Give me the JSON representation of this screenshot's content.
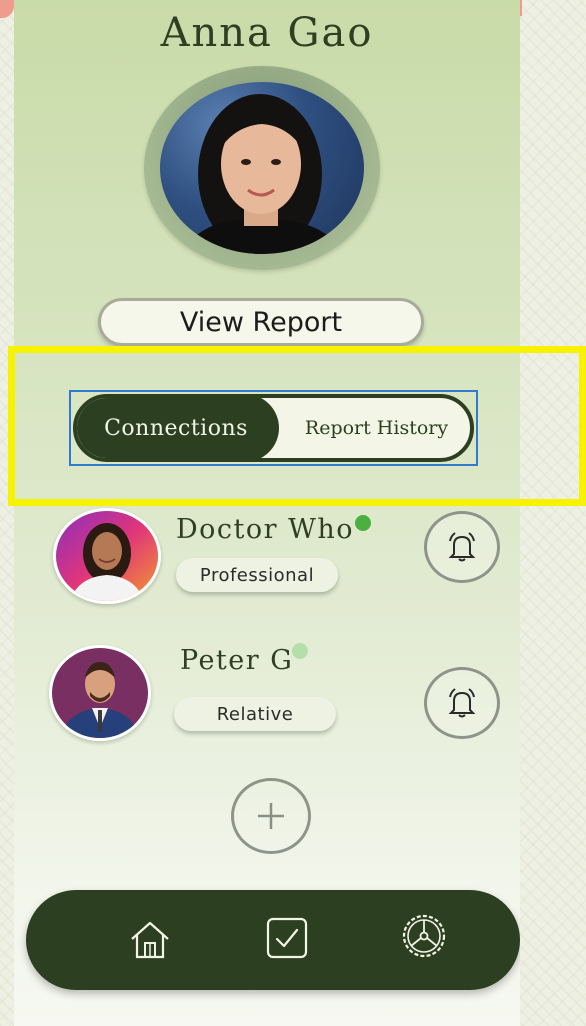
{
  "profile": {
    "name": "Anna Gao"
  },
  "actions": {
    "view_report_label": "View Report"
  },
  "tabs": [
    {
      "label": "Connections",
      "active": true
    },
    {
      "label": "Report History",
      "active": false
    }
  ],
  "connections": [
    {
      "name": "Doctor Who",
      "role": "Professional",
      "status": "online",
      "status_color": "#4caf3f"
    },
    {
      "name": "Peter G",
      "role": "Relative",
      "status": "away",
      "status_color": "#b5dfa9"
    }
  ],
  "nav": {
    "items": [
      {
        "icon": "home-icon"
      },
      {
        "icon": "checkbox-icon"
      },
      {
        "icon": "settings-icon"
      }
    ]
  },
  "colors": {
    "primary_dark": "#2c3f20",
    "highlight": "#f7f200",
    "focus_outline": "#2f7ccf"
  }
}
